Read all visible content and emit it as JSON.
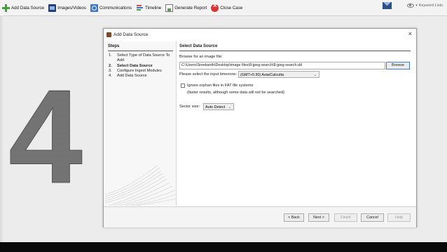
{
  "toolbar": {
    "items": [
      {
        "label": "Add Data Source",
        "icon": "plus-icon"
      },
      {
        "label": "Images/Videos",
        "icon": "images-icon"
      },
      {
        "label": "Communications",
        "icon": "communications-icon"
      },
      {
        "label": "Timeline",
        "icon": "timeline-icon"
      },
      {
        "label": "Generate Report",
        "icon": "report-icon"
      },
      {
        "label": "Close Case",
        "icon": "close-case-icon"
      }
    ],
    "keyword_lists": "Keyword Lists"
  },
  "overlay": {
    "big_number": "4"
  },
  "dialog": {
    "title": "Add Data Source",
    "close": "×",
    "steps_heading": "Steps",
    "steps": [
      {
        "num": "1.",
        "label": "Select Type of Data Source To Add"
      },
      {
        "num": "2.",
        "label": "Select Data Source"
      },
      {
        "num": "3.",
        "label": "Configure Ingest Modules"
      },
      {
        "num": "4.",
        "label": "Add Data Source"
      }
    ],
    "active_step": 2,
    "content_heading": "Select Data Source",
    "browse_label": "Browse for an image file:",
    "path_value": "C:\\Users\\Sreekanth\\Desktop\\image files\\8-jpeg-search\\8-jpeg-search.dd",
    "browse_button": "Browse",
    "timezone_label": "Please select the input timezone:",
    "timezone_value": "(GMT+5:30) Asia/Calcutta",
    "ignore_orphan_label": "Ignore orphan files in FAT file systems",
    "ignore_orphan_checked": false,
    "ignore_orphan_note": "(faster results, although some data will not be searched)",
    "sector_label": "Sector size:",
    "sector_value": "Auto Detect",
    "footer_buttons": {
      "back": "< Back",
      "next": "Next >",
      "finish": "Finish",
      "cancel": "Cancel",
      "help": "Help"
    }
  },
  "colors": {
    "accent": "#3d7bd1",
    "background": "#ececec"
  }
}
